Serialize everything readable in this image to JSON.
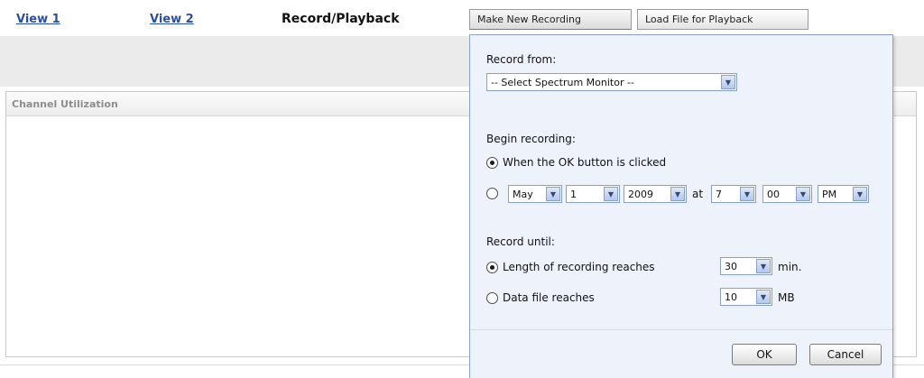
{
  "nav": {
    "view1": "View 1",
    "view2": "View 2",
    "current": "Record/Playback",
    "tab_new_recording": "Make New Recording",
    "tab_load_file": "Load File for Playback"
  },
  "panel": {
    "title": "Channel Utilization"
  },
  "dialog": {
    "record_from_label": "Record from:",
    "spectrum_monitor_select": "-- Select Spectrum Monitor --",
    "begin_label": "Begin recording:",
    "begin_option_ok": "When the OK button is clicked",
    "begin_option_ok_selected": true,
    "schedule": {
      "month": "May",
      "day": "1",
      "year": "2009",
      "at_label": "at",
      "hour": "7",
      "minute": "00",
      "ampm": "PM"
    },
    "until_label": "Record until:",
    "until_length_label": "Length of recording reaches",
    "until_length_value": "30",
    "until_length_unit": "min.",
    "until_length_selected": true,
    "until_file_label": "Data file reaches",
    "until_file_value": "10",
    "until_file_unit": "MB",
    "ok_label": "OK",
    "cancel_label": "Cancel"
  },
  "colors": {
    "link": "#2a4f9e",
    "dialog_bg": "#eef3fb",
    "dialog_border": "#8aa2c8",
    "toolbar_gray": "#ebebeb"
  }
}
